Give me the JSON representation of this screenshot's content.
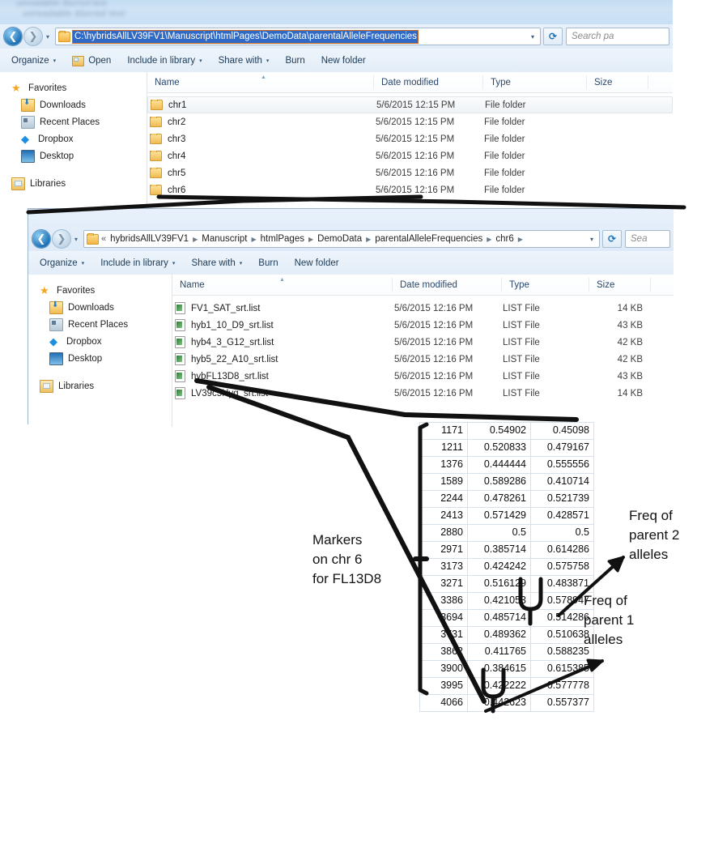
{
  "blurred_header": {
    "line1": "unreadable blurred text",
    "line2": "unreadable blurred text"
  },
  "window_top": {
    "nav": {
      "back_icon": "back-arrow-icon",
      "forward_icon": "forward-arrow-icon",
      "history_caret": "▾",
      "address_value": "C:\\hybridsAllLV39FV1\\Manuscript\\htmlPages\\DemoData\\parentalAlleleFrequencies",
      "address_dropdown": "▾",
      "refresh_icon": "refresh-icon",
      "search_placeholder": "Search pa"
    },
    "toolbar": [
      {
        "label": "Organize",
        "caret": "▾",
        "icon": ""
      },
      {
        "label": "Open",
        "caret": "",
        "icon": "open-folder-icon"
      },
      {
        "label": "Include in library",
        "caret": "▾",
        "icon": ""
      },
      {
        "label": "Share with",
        "caret": "▾",
        "icon": ""
      },
      {
        "label": "Burn",
        "caret": "",
        "icon": ""
      },
      {
        "label": "New folder",
        "caret": "",
        "icon": ""
      }
    ],
    "sidebar": [
      {
        "label": "Favorites",
        "icon": "star-icon",
        "sub": false
      },
      {
        "label": "Downloads",
        "icon": "downloads-icon",
        "sub": true
      },
      {
        "label": "Recent Places",
        "icon": "recent-places-icon",
        "sub": true
      },
      {
        "label": "Dropbox",
        "icon": "dropbox-icon",
        "sub": true
      },
      {
        "label": "Desktop",
        "icon": "desktop-icon",
        "sub": true
      },
      {
        "label": "Libraries",
        "icon": "libraries-icon",
        "sub": false
      }
    ],
    "columns": [
      "Name",
      "Date modified",
      "Type",
      "Size"
    ],
    "rows": [
      {
        "name": "chr1",
        "date": "5/6/2015 12:15 PM",
        "type": "File folder",
        "size": "",
        "selected": true
      },
      {
        "name": "chr2",
        "date": "5/6/2015 12:15 PM",
        "type": "File folder",
        "size": "",
        "selected": false
      },
      {
        "name": "chr3",
        "date": "5/6/2015 12:15 PM",
        "type": "File folder",
        "size": "",
        "selected": false
      },
      {
        "name": "chr4",
        "date": "5/6/2015 12:16 PM",
        "type": "File folder",
        "size": "",
        "selected": false
      },
      {
        "name": "chr5",
        "date": "5/6/2015 12:16 PM",
        "type": "File folder",
        "size": "",
        "selected": false
      },
      {
        "name": "chr6",
        "date": "5/6/2015 12:16 PM",
        "type": "File folder",
        "size": "",
        "selected": false
      }
    ]
  },
  "window_bottom": {
    "nav": {
      "back_icon": "back-arrow-icon",
      "forward_icon": "forward-arrow-icon",
      "history_caret": "▾",
      "breadcrumb_lead": "«",
      "breadcrumbs": [
        "hybridsAllLV39FV1",
        "Manuscript",
        "htmlPages",
        "DemoData",
        "parentalAlleleFrequencies",
        "chr6"
      ],
      "address_dropdown": "▾",
      "refresh_icon": "refresh-icon",
      "search_placeholder": "Sea"
    },
    "toolbar": [
      {
        "label": "Organize",
        "caret": "▾",
        "icon": ""
      },
      {
        "label": "Include in library",
        "caret": "▾",
        "icon": ""
      },
      {
        "label": "Share with",
        "caret": "▾",
        "icon": ""
      },
      {
        "label": "Burn",
        "caret": "",
        "icon": ""
      },
      {
        "label": "New folder",
        "caret": "",
        "icon": ""
      }
    ],
    "sidebar": [
      {
        "label": "Favorites",
        "icon": "star-icon",
        "sub": false
      },
      {
        "label": "Downloads",
        "icon": "downloads-icon",
        "sub": true
      },
      {
        "label": "Recent Places",
        "icon": "recent-places-icon",
        "sub": true
      },
      {
        "label": "Dropbox",
        "icon": "dropbox-icon",
        "sub": true
      },
      {
        "label": "Desktop",
        "icon": "desktop-icon",
        "sub": true
      },
      {
        "label": "Libraries",
        "icon": "libraries-icon",
        "sub": false
      }
    ],
    "columns": [
      "Name",
      "Date modified",
      "Type",
      "Size"
    ],
    "rows": [
      {
        "name": "FV1_SAT_srt.list",
        "date": "5/6/2015 12:16 PM",
        "type": "LIST File",
        "size": "14 KB"
      },
      {
        "name": "hyb1_10_D9_srt.list",
        "date": "5/6/2015 12:16 PM",
        "type": "LIST File",
        "size": "43 KB"
      },
      {
        "name": "hyb4_3_G12_srt.list",
        "date": "5/6/2015 12:16 PM",
        "type": "LIST File",
        "size": "42 KB"
      },
      {
        "name": "hyb5_22_A10_srt.list",
        "date": "5/6/2015 12:16 PM",
        "type": "LIST File",
        "size": "42 KB"
      },
      {
        "name": "hybFL13D8_srt.list",
        "date": "5/6/2015 12:16 PM",
        "type": "LIST File",
        "size": "43 KB"
      },
      {
        "name": "LV39c5Hyg_srt.list",
        "date": "5/6/2015 12:16 PM",
        "type": "LIST File",
        "size": "14 KB"
      }
    ]
  },
  "sheet": {
    "columns": [
      "marker_position",
      "freq_parent_1",
      "freq_parent_2"
    ],
    "rows": [
      [
        "1171",
        "0.54902",
        "0.45098"
      ],
      [
        "1211",
        "0.520833",
        "0.479167"
      ],
      [
        "1376",
        "0.444444",
        "0.555556"
      ],
      [
        "1589",
        "0.589286",
        "0.410714"
      ],
      [
        "2244",
        "0.478261",
        "0.521739"
      ],
      [
        "2413",
        "0.571429",
        "0.428571"
      ],
      [
        "2880",
        "0.5",
        "0.5"
      ],
      [
        "2971",
        "0.385714",
        "0.614286"
      ],
      [
        "3173",
        "0.424242",
        "0.575758"
      ],
      [
        "3271",
        "0.516129",
        "0.483871"
      ],
      [
        "3386",
        "0.421053",
        "0.578947"
      ],
      [
        "3694",
        "0.485714",
        "0.514286"
      ],
      [
        "3731",
        "0.489362",
        "0.510638"
      ],
      [
        "3862",
        "0.411765",
        "0.588235"
      ],
      [
        "3900",
        "0.384615",
        "0.615385"
      ],
      [
        "3995",
        "0.422222",
        "0.577778"
      ],
      [
        "4066",
        "0.442623",
        "0.557377"
      ]
    ]
  },
  "annotations": {
    "markers": "Markers\non chr 6\nfor FL13D8",
    "parent2": "Freq of\nparent 2\nalleles",
    "parent1": "Freq of\nparent 1\nalleles"
  }
}
